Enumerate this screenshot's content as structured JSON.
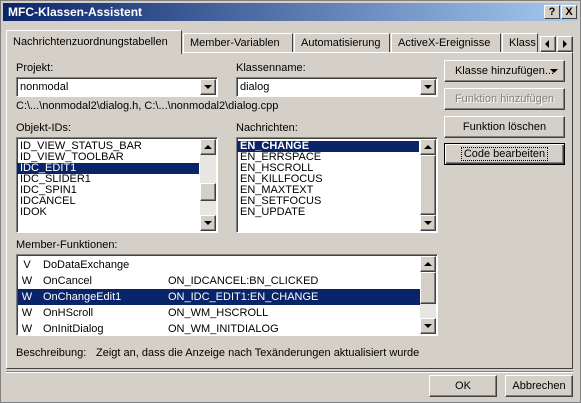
{
  "window": {
    "title": "MFC-Klassen-Assistent",
    "help_label": "?",
    "close_label": "X"
  },
  "tabs": [
    {
      "label": "Nachrichtenzuordnungstabellen",
      "active": true
    },
    {
      "label": "Member-Variablen"
    },
    {
      "label": "Automatisierung"
    },
    {
      "label": "ActiveX-Ereignisse"
    },
    {
      "label": "Klass"
    }
  ],
  "project": {
    "label": "Projekt:",
    "value": "nonmodal"
  },
  "classname": {
    "label": "Klassenname:",
    "value": "dialog"
  },
  "filepath": "C:\\...\\nonmodal2\\dialog.h, C:\\...\\nonmodal2\\dialog.cpp",
  "object_ids": {
    "label": "Objekt-IDs:",
    "items": [
      "ID_VIEW_STATUS_BAR",
      "ID_VIEW_TOOLBAR",
      "IDC_EDIT1",
      "IDC_SLIDER1",
      "IDC_SPIN1",
      "IDCANCEL",
      "IDOK"
    ],
    "selected": 2
  },
  "messages": {
    "label": "Nachrichten:",
    "items": [
      "EN_CHANGE",
      "EN_ERRSPACE",
      "EN_HSCROLL",
      "EN_KILLFOCUS",
      "EN_MAXTEXT",
      "EN_SETFOCUS",
      "EN_UPDATE"
    ],
    "selected": 0
  },
  "member_functions": {
    "label": "Member-Funktionen:",
    "rows": [
      {
        "type": "V",
        "name": "DoDataExchange",
        "message": ""
      },
      {
        "type": "W",
        "name": "OnCancel",
        "message": "ON_IDCANCEL:BN_CLICKED"
      },
      {
        "type": "W",
        "name": "OnChangeEdit1",
        "message": "ON_IDC_EDIT1:EN_CHANGE"
      },
      {
        "type": "W",
        "name": "OnHScroll",
        "message": "ON_WM_HSCROLL"
      },
      {
        "type": "W",
        "name": "OnInitDialog",
        "message": "ON_WM_INITDIALOG"
      }
    ],
    "selected": 2
  },
  "description": {
    "label": "Beschreibung:",
    "text": "Zeigt an, dass die Anzeige nach Texänderungen aktualisiert wurde"
  },
  "buttons": {
    "add_class": "Klasse hinzufügen...",
    "add_function": "Funktion hinzufügen",
    "delete_function": "Funktion löschen",
    "edit_code": "Code bearbeiten",
    "ok": "OK",
    "cancel": "Abbrechen"
  },
  "colors": {
    "title_start": "#0a246a",
    "title_end": "#a6caf0",
    "selection": "#0a246a",
    "face": "#d4d0c8"
  }
}
